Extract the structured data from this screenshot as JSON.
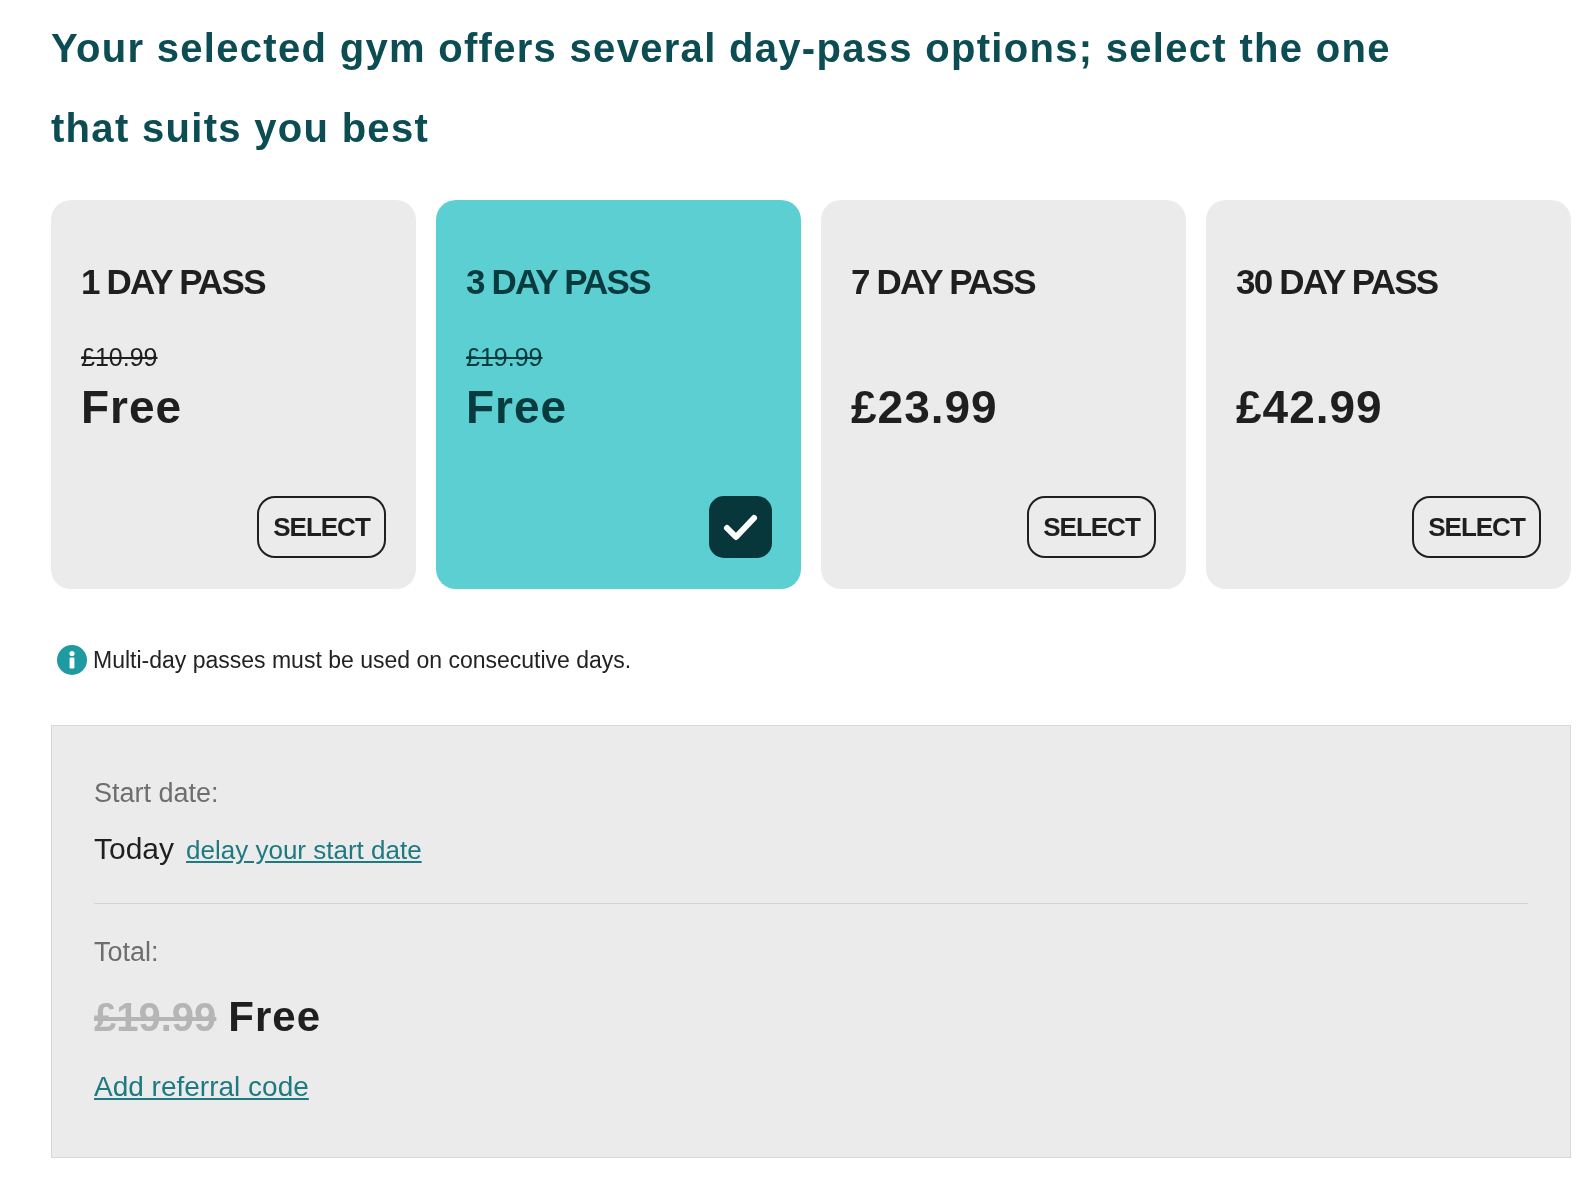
{
  "heading": "Your selected gym offers several day-pass options; select the one that suits you best",
  "passes": [
    {
      "title": "1 DAY PASS",
      "original_price": "£10.99",
      "price": "Free",
      "selected": false,
      "button": "SELECT"
    },
    {
      "title": "3 DAY PASS",
      "original_price": "£19.99",
      "price": "Free",
      "selected": true
    },
    {
      "title": "7 DAY PASS",
      "price": "£23.99",
      "selected": false,
      "button": "SELECT"
    },
    {
      "title": "30 DAY PASS",
      "price": "£42.99",
      "selected": false,
      "button": "SELECT"
    }
  ],
  "note": "Multi-day passes must be used on consecutive days.",
  "summary": {
    "start_label": "Start date:",
    "start_value": "Today",
    "delay_link": "delay your start date",
    "total_label": "Total:",
    "total_original": "£19.99",
    "total_price": "Free",
    "referral_link": "Add referral code"
  }
}
